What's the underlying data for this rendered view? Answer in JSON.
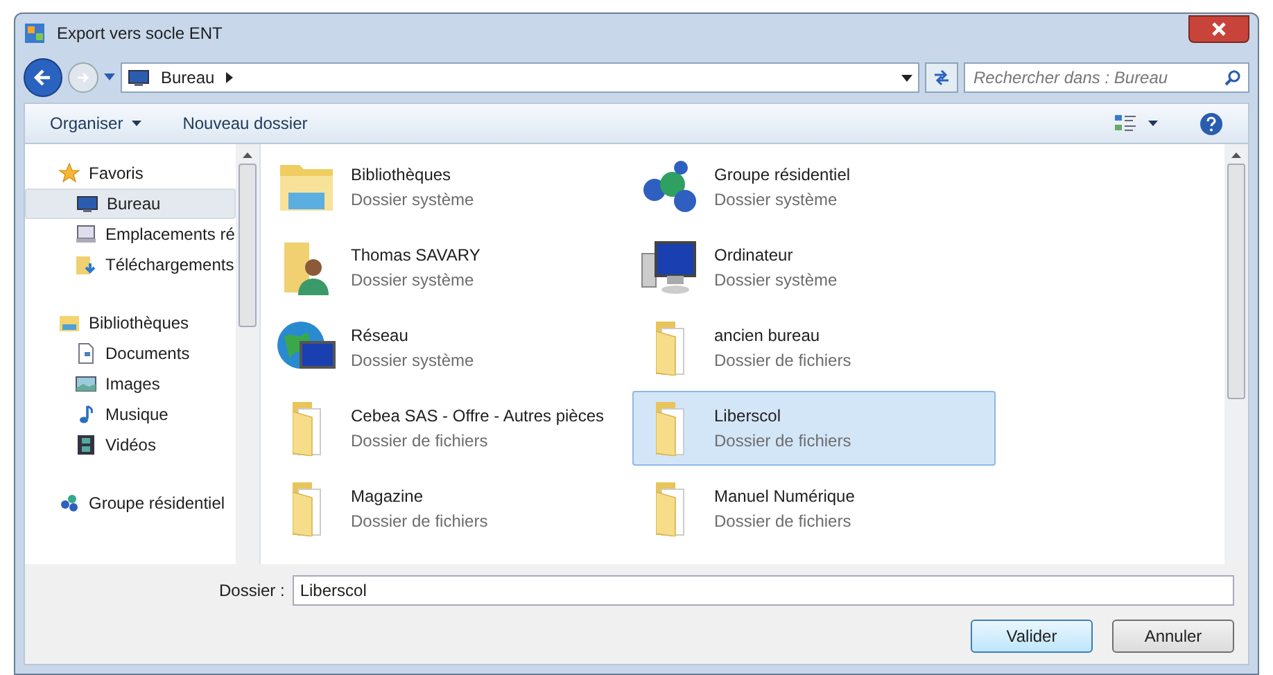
{
  "window": {
    "title": "Export vers socle ENT"
  },
  "address": {
    "location": "Bureau",
    "search_placeholder": "Rechercher dans : Bureau"
  },
  "toolbar": {
    "organize": "Organiser",
    "new_folder": "Nouveau dossier"
  },
  "sidebar": {
    "items": [
      {
        "kind": "group",
        "label": "Favoris",
        "selected": false
      },
      {
        "kind": "item",
        "label": "Bureau",
        "selected": true
      },
      {
        "kind": "item",
        "label": "Emplacements ré",
        "selected": false
      },
      {
        "kind": "item",
        "label": "Téléchargements",
        "selected": false
      },
      {
        "kind": "spacer"
      },
      {
        "kind": "group",
        "label": "Bibliothèques",
        "selected": false
      },
      {
        "kind": "item",
        "label": "Documents",
        "selected": false
      },
      {
        "kind": "item",
        "label": "Images",
        "selected": false
      },
      {
        "kind": "item",
        "label": "Musique",
        "selected": false
      },
      {
        "kind": "item",
        "label": "Vidéos",
        "selected": false
      },
      {
        "kind": "spacer"
      },
      {
        "kind": "group",
        "label": "Groupe résidentiel",
        "selected": false
      }
    ]
  },
  "files": [
    {
      "kind": "library",
      "name": "Bibliothèques",
      "type": "Dossier système",
      "selected": false
    },
    {
      "kind": "homegroup",
      "name": "Groupe résidentiel",
      "type": "Dossier système",
      "selected": false
    },
    {
      "kind": "user",
      "name": "Thomas SAVARY",
      "type": "Dossier système",
      "selected": false
    },
    {
      "kind": "computer",
      "name": "Ordinateur",
      "type": "Dossier système",
      "selected": false
    },
    {
      "kind": "network",
      "name": "Réseau",
      "type": "Dossier système",
      "selected": false
    },
    {
      "kind": "folder",
      "name": "ancien bureau",
      "type": "Dossier de fichiers",
      "selected": false
    },
    {
      "kind": "folder",
      "name": "Cebea SAS - Offre - Autres pièces",
      "type": "Dossier de fichiers",
      "selected": false
    },
    {
      "kind": "folder",
      "name": "Liberscol",
      "type": "Dossier de fichiers",
      "selected": true
    },
    {
      "kind": "folder",
      "name": "Magazine",
      "type": "Dossier de fichiers",
      "selected": false
    },
    {
      "kind": "folder",
      "name": "Manuel Numérique",
      "type": "Dossier de fichiers",
      "selected": false
    }
  ],
  "folder_field": {
    "label": "Dossier :",
    "value": "Liberscol"
  },
  "buttons": {
    "ok": "Valider",
    "cancel": "Annuler"
  }
}
